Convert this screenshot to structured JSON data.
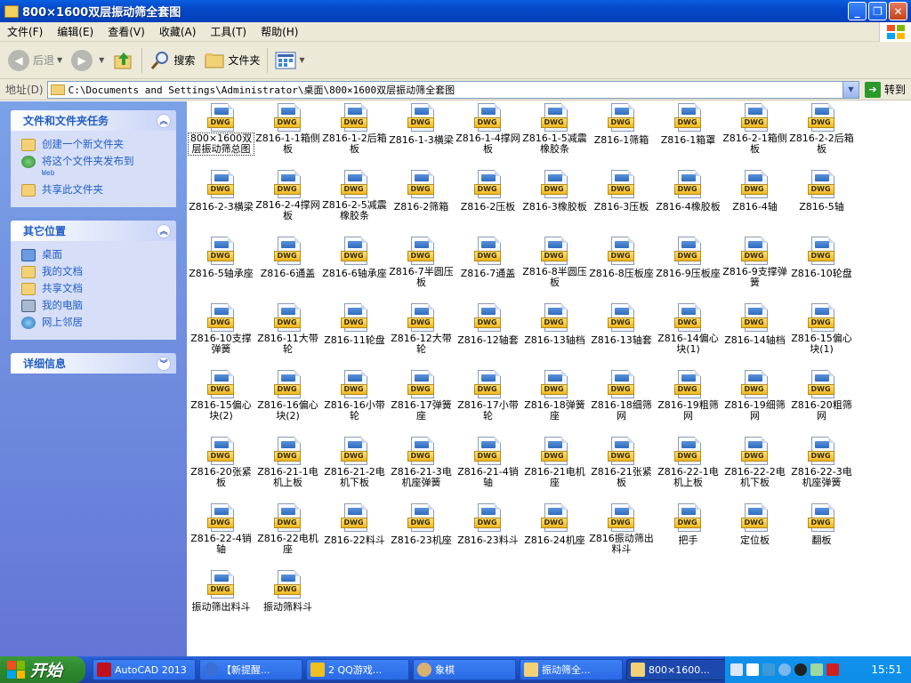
{
  "window": {
    "title": "800×1600双层振动筛全套图"
  },
  "menu": [
    "文件(F)",
    "编辑(E)",
    "查看(V)",
    "收藏(A)",
    "工具(T)",
    "帮助(H)"
  ],
  "toolbar": {
    "back_label": "后退",
    "search_label": "搜索",
    "folders_label": "文件夹"
  },
  "address": {
    "label": "地址(D)",
    "value": "C:\\Documents and Settings\\Administrator\\桌面\\800×1600双层振动筛全套图",
    "go_label": "转到"
  },
  "sidebar": {
    "tasks": {
      "title": "文件和文件夹任务",
      "items": [
        {
          "label": "创建一个新文件夹",
          "sub": "",
          "icon": "new-folder-icon"
        },
        {
          "label": "将这个文件夹发布到",
          "sub": "Web",
          "icon": "publish-web-icon"
        },
        {
          "label": "共享此文件夹",
          "sub": "",
          "icon": "share-folder-icon"
        }
      ]
    },
    "places": {
      "title": "其它位置",
      "items": [
        {
          "label": "桌面",
          "icon": "desktop-icon"
        },
        {
          "label": "我的文档",
          "icon": "my-documents-icon"
        },
        {
          "label": "共享文档",
          "icon": "shared-documents-icon"
        },
        {
          "label": "我的电脑",
          "icon": "my-computer-icon"
        },
        {
          "label": "网上邻居",
          "icon": "network-places-icon"
        }
      ]
    },
    "details": {
      "title": "详细信息"
    }
  },
  "file_badge": "DWG",
  "files": [
    "800×1600双层振动筛总图",
    "Z816-1-1箱侧板",
    "Z816-1-2后箱板",
    "Z816-1-3横梁",
    "Z816-1-4撑网板",
    "Z816-1-5减震橡胶条",
    "Z816-1筛箱",
    "Z816-1箱罩",
    "Z816-2-1箱侧板",
    "Z816-2-2后箱板",
    "Z816-2-3横梁",
    "Z816-2-4撑网板",
    "Z816-2-5减震橡胶条",
    "Z816-2筛箱",
    "Z816-2压板",
    "Z816-3橡胶板",
    "Z816-3压板",
    "Z816-4橡胶板",
    "Z816-4轴",
    "Z816-5轴",
    "Z816-5轴承座",
    "Z816-6通盖",
    "Z816-6轴承座",
    "Z816-7半圆压板",
    "Z816-7通盖",
    "Z816-8半圆压板",
    "Z816-8压板座",
    "Z816-9压板座",
    "Z816-9支撑弹簧",
    "Z816-10轮盘",
    "Z816-10支撑弹簧",
    "Z816-11大带轮",
    "Z816-11轮盘",
    "Z816-12大带轮",
    "Z816-12轴套",
    "Z816-13轴档",
    "Z816-13轴套",
    "Z816-14偏心块(1)",
    "Z816-14轴档",
    "Z816-15偏心块(1)",
    "Z816-15偏心块(2)",
    "Z816-16偏心块(2)",
    "Z816-16小带轮",
    "Z816-17弹簧座",
    "Z816-17小带轮",
    "Z816-18弹簧座",
    "Z816-18细筛网",
    "Z816-19粗筛网",
    "Z816-19细筛网",
    "Z816-20粗筛网",
    "Z816-20张紧板",
    "Z816-21-1电机上板",
    "Z816-21-2电机下板",
    "Z816-21-3电机座弹簧",
    "Z816-21-4销轴",
    "Z816-21电机座",
    "Z816-21张紧板",
    "Z816-22-1电机上板",
    "Z816-22-2电机下板",
    "Z816-22-3电机座弹簧",
    "Z816-22-4销轴",
    "Z816-22电机座",
    "Z816-22料斗",
    "Z816-23机座",
    "Z816-23料斗",
    "Z816-24机座",
    "Z816振动筛出料斗",
    "把手",
    "定位板",
    "翻板",
    "振动筛出料斗",
    "振动筛料斗"
  ],
  "taskbar": {
    "start_label": "开始",
    "tasks": [
      {
        "label": "AutoCAD 2013",
        "color": "#c0101c"
      },
      {
        "label": "【新提醒...",
        "color": "#3a6fd8"
      },
      {
        "label": "2 QQ游戏...",
        "color": "#f0c020"
      },
      {
        "label": "象棋",
        "color": "#d8b070"
      },
      {
        "label": "振动筛全...",
        "color": "#f3d277"
      },
      {
        "label": "800×1600...",
        "color": "#f3d277"
      }
    ],
    "clock": "15:51"
  }
}
